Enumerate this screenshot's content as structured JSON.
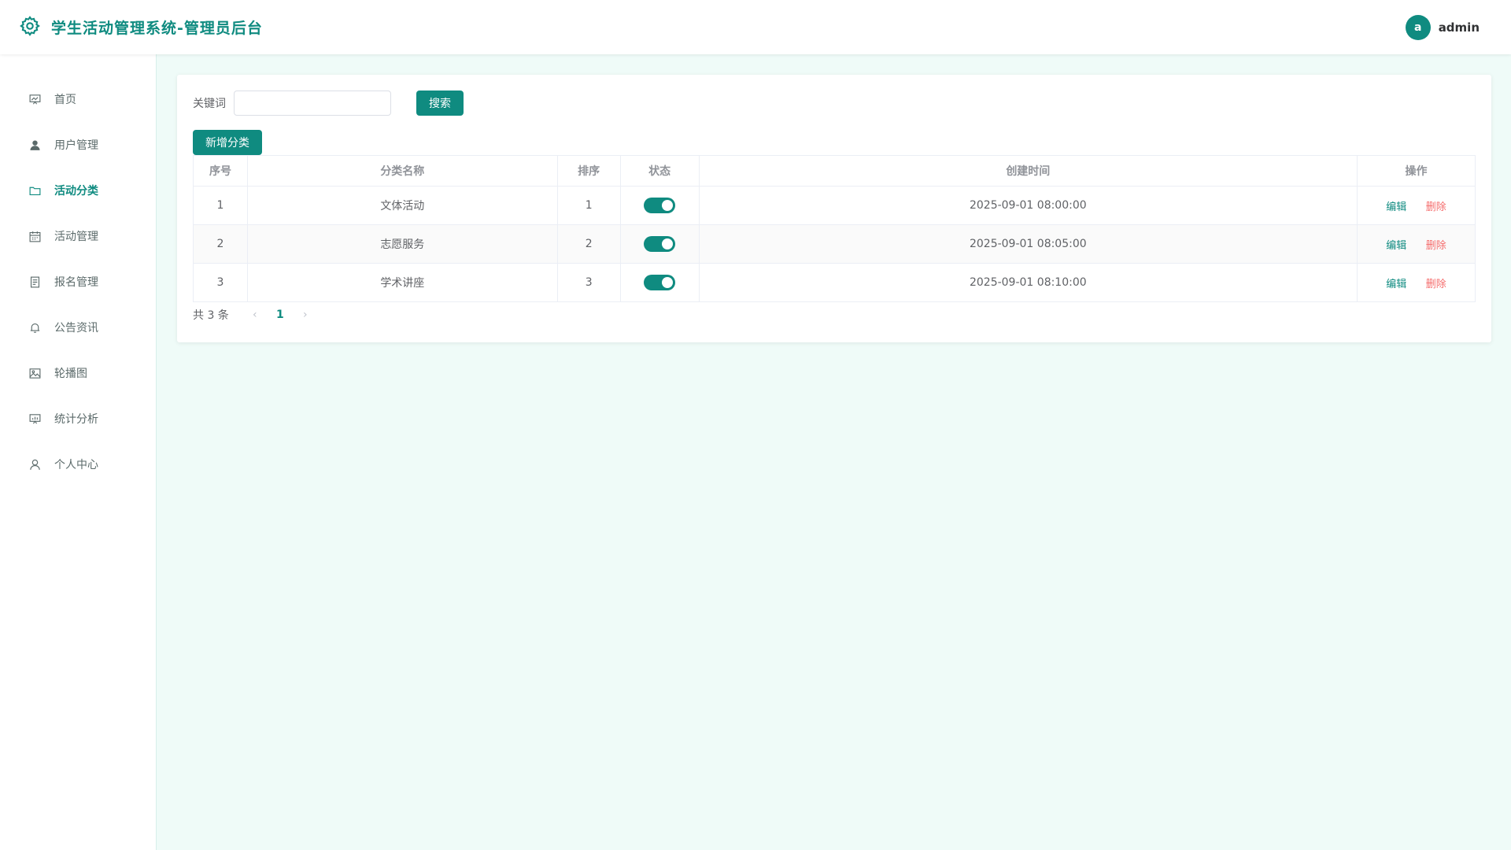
{
  "header": {
    "title": "学生活动管理系统-管理员后台",
    "user": {
      "avatar_letter": "a",
      "name": "admin"
    }
  },
  "colors": {
    "primary": "#0f8b80",
    "danger": "#f56c6c",
    "page_bg": "#effbf8"
  },
  "sidebar": {
    "items": [
      {
        "label": "首页",
        "icon": "presentation-chart-icon",
        "active": false
      },
      {
        "label": "用户管理",
        "icon": "user-icon",
        "active": false
      },
      {
        "label": "活动分类",
        "icon": "folder-icon",
        "active": true
      },
      {
        "label": "活动管理",
        "icon": "calendar-icon",
        "active": false
      },
      {
        "label": "报名管理",
        "icon": "document-icon",
        "active": false
      },
      {
        "label": "公告资讯",
        "icon": "bell-icon",
        "active": false
      },
      {
        "label": "轮播图",
        "icon": "picture-icon",
        "active": false
      },
      {
        "label": "统计分析",
        "icon": "data-board-icon",
        "active": false
      },
      {
        "label": "个人中心",
        "icon": "user-outline-icon",
        "active": false
      }
    ]
  },
  "search": {
    "label": "关键词",
    "value": "",
    "placeholder": "",
    "button_label": "搜索"
  },
  "toolbar": {
    "add_label": "新增分类"
  },
  "table": {
    "columns": [
      "序号",
      "分类名称",
      "排序",
      "状态",
      "创建时间",
      "操作"
    ],
    "rows": [
      {
        "index": "1",
        "name": "文体活动",
        "sort": "1",
        "enabled": true,
        "created": "2025-09-01 08:00:00"
      },
      {
        "index": "2",
        "name": "志愿服务",
        "sort": "2",
        "enabled": true,
        "created": "2025-09-01 08:05:00"
      },
      {
        "index": "3",
        "name": "学术讲座",
        "sort": "3",
        "enabled": true,
        "created": "2025-09-01 08:10:00"
      }
    ],
    "actions": {
      "edit": "编辑",
      "delete": "删除"
    }
  },
  "pagination": {
    "total_text": "共 3 条",
    "current_page": "1",
    "prev": "‹",
    "next": "›"
  }
}
